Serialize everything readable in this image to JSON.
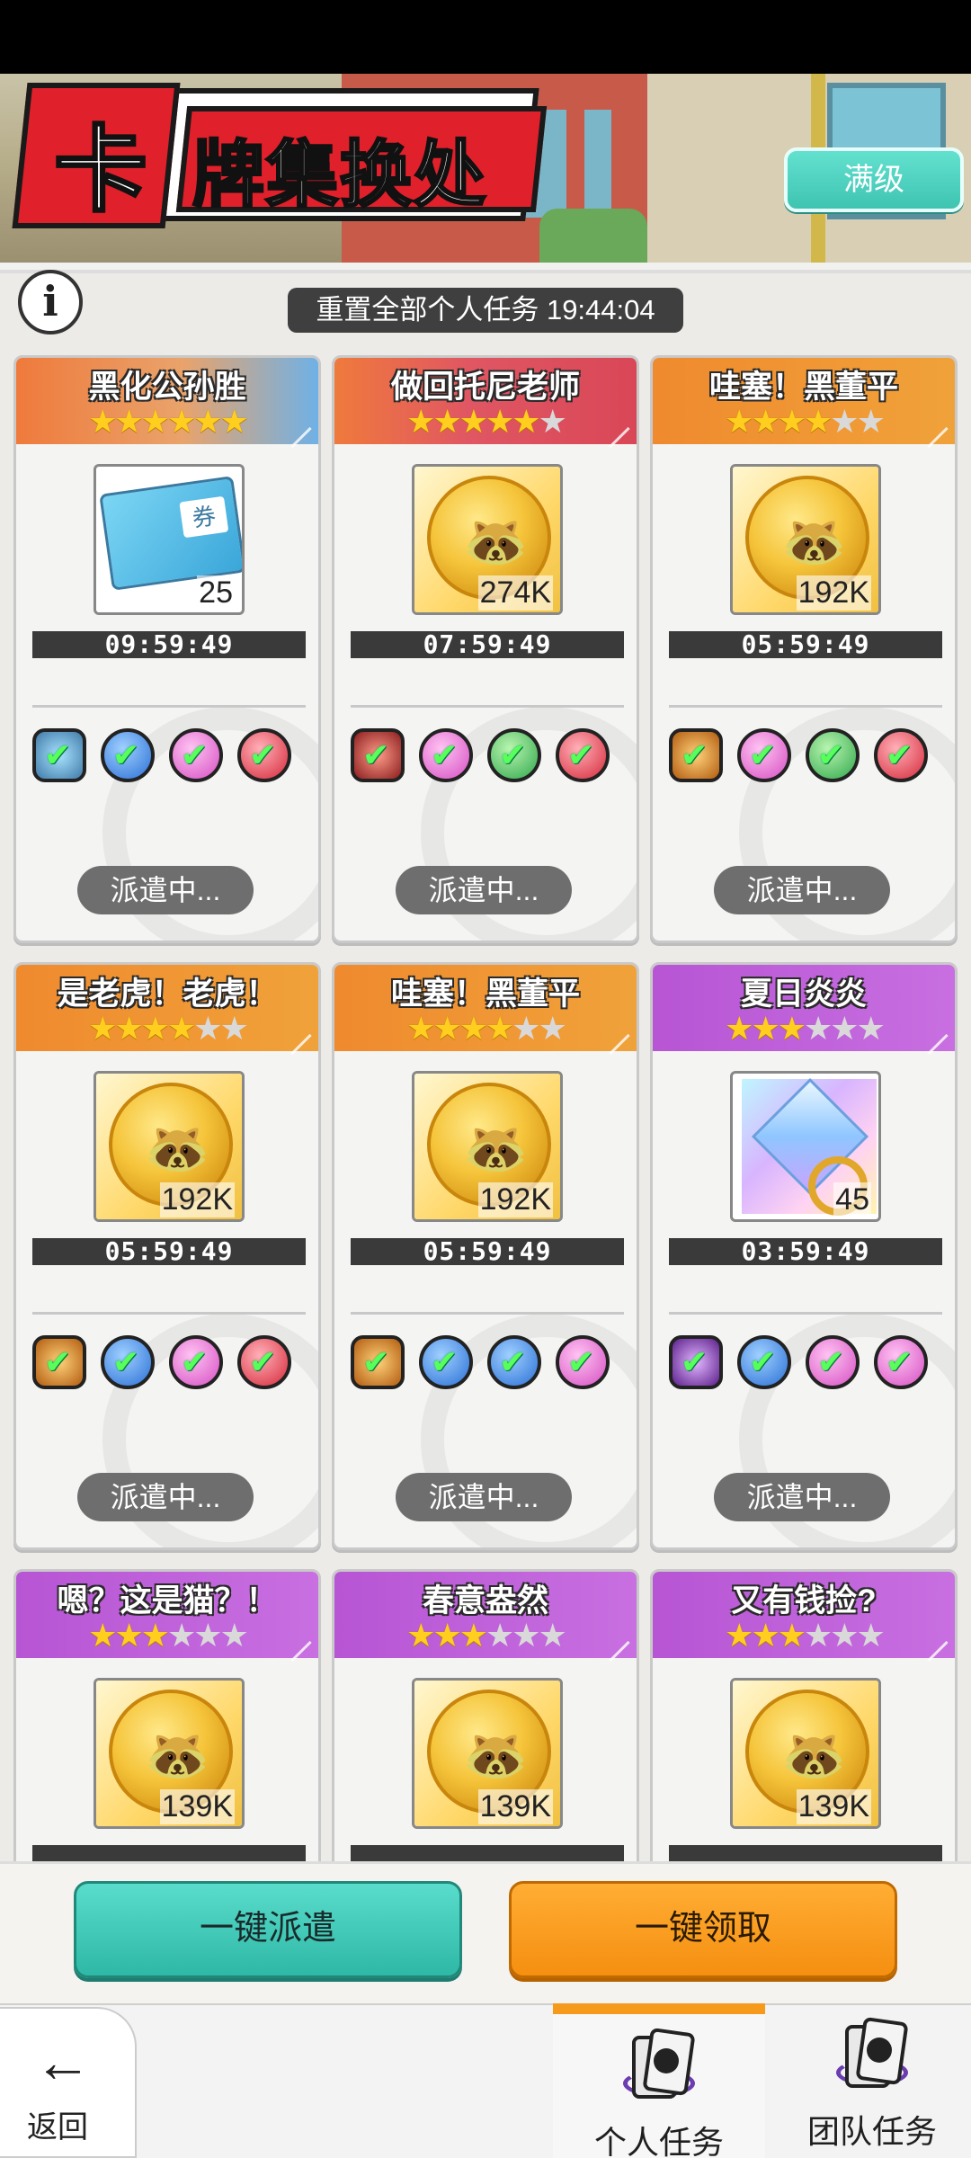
{
  "header": {
    "logo_char": "卡",
    "logo_text": "牌集换处",
    "max_level_label": "满级"
  },
  "info_icon_label": "i",
  "reset_text": "重置全部个人任务 19:44:04",
  "cards": [
    {
      "name": "黑化公孙胜",
      "stars": 6,
      "total": 6,
      "reward": "ticket",
      "amount": "25",
      "timer": "09:59:49",
      "status": "派遣中..."
    },
    {
      "name": "做回托尼老师",
      "stars": 5,
      "total": 6,
      "reward": "coin",
      "amount": "274K",
      "timer": "07:59:49",
      "status": "派遣中..."
    },
    {
      "name": "哇塞！黑董平",
      "stars": 4,
      "total": 6,
      "reward": "coin",
      "amount": "192K",
      "timer": "05:59:49",
      "status": "派遣中..."
    },
    {
      "name": "是老虎！老虎！",
      "stars": 4,
      "total": 6,
      "reward": "coin",
      "amount": "192K",
      "timer": "05:59:49",
      "status": "派遣中..."
    },
    {
      "name": "哇塞！黑董平",
      "stars": 4,
      "total": 6,
      "reward": "coin",
      "amount": "192K",
      "timer": "05:59:49",
      "status": "派遣中..."
    },
    {
      "name": "夏日炎炎",
      "stars": 3,
      "total": 6,
      "reward": "ring",
      "amount": "45",
      "timer": "03:59:49",
      "status": "派遣中..."
    },
    {
      "name": "嗯？这是猫？！",
      "stars": 3,
      "total": 6,
      "reward": "coin",
      "amount": "139K",
      "timer": "",
      "status": ""
    },
    {
      "name": "春意盎然",
      "stars": 3,
      "total": 6,
      "reward": "coin",
      "amount": "139K",
      "timer": "",
      "status": ""
    },
    {
      "name": "又有钱捡?",
      "stars": 3,
      "total": 6,
      "reward": "coin",
      "amount": "139K",
      "timer": "",
      "status": ""
    }
  ],
  "actions": {
    "dispatch_all": "一键派遣",
    "claim_all": "一键领取"
  },
  "nav": {
    "back_label": "返回",
    "tab_personal": "个人任务",
    "tab_team": "团队任务",
    "active_tab": "个人任务"
  },
  "colors": {
    "accent_orange": "#f59a1a",
    "teal_button": "#2fb8a6",
    "orange_button": "#f58f10"
  }
}
